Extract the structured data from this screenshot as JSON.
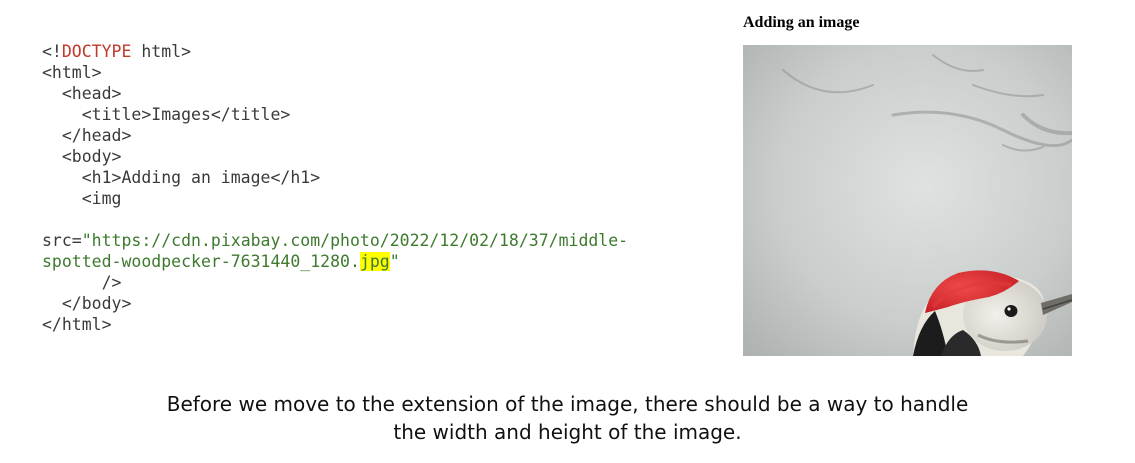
{
  "code": {
    "l1_prefix": "<!",
    "l1_doctype": "DOCTYPE",
    "l1_suffix": " html>",
    "l2": "<html>",
    "l3": "  <head>",
    "l4": "    <title>Images</title>",
    "l5": "  </head>",
    "l6": "  <body>",
    "l7": "    <h1>Adding an image</h1>",
    "l8": "    <img",
    "l9": "",
    "l10_attr": "src=",
    "l10_value": "\"https://cdn.pixabay.com/photo/2022/12/02/18/37/middle-",
    "l11_value": "spotted-woodpecker-7631440_1280.",
    "l11_highlight": "jpg",
    "l11_end": "\"",
    "l12": "      />",
    "l13": "  </body>",
    "l14": "</html>"
  },
  "preview": {
    "heading": "Adding an image",
    "image_subject": "middle spotted woodpecker photo"
  },
  "caption": {
    "line1": "Before we move to the extension of the image, there should be a way to handle",
    "line2": "the width and height of the image."
  },
  "colors": {
    "doctype": "#c0392b",
    "string": "#3d7a2e",
    "highlight": "#ffff00"
  }
}
